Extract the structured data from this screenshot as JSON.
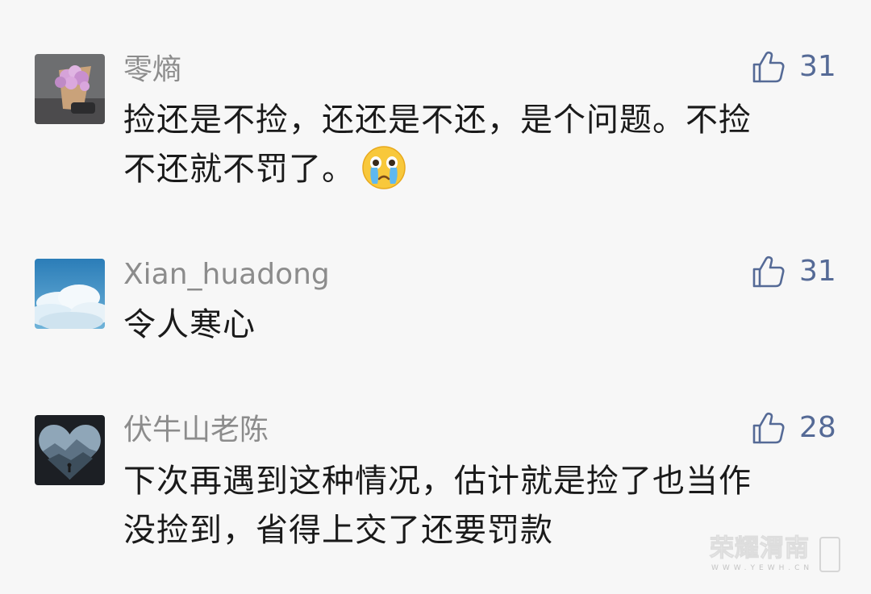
{
  "comments": [
    {
      "username": "零熵",
      "likes": "31",
      "text_lines": [
        "捡还是不捡，还还是不还，是个问题。不捡",
        "不还就不罚了。"
      ],
      "emoji": "crying-face-emoji",
      "avatar": "flower-bouquet-avatar"
    },
    {
      "username": "Xian_huadong",
      "likes": "31",
      "text_lines": [
        "令人寒心"
      ],
      "avatar": "cloud-sky-avatar"
    },
    {
      "username": "伏牛山老陈",
      "likes": "28",
      "text_lines": [
        "下次再遇到这种情况，估计就是捡了也当作",
        "没捡到，省得上交了还要罚款"
      ],
      "avatar": "mountain-heart-avatar"
    }
  ],
  "watermark": {
    "text": "荣耀渭南",
    "sub": "WWW.YEWH.CN"
  },
  "colors": {
    "background": "#f7f7f7",
    "username": "#8c8c8c",
    "like": "#556a96",
    "body_text": "#1a1a1a"
  },
  "icons": {
    "like": "thumbs-up-icon"
  }
}
